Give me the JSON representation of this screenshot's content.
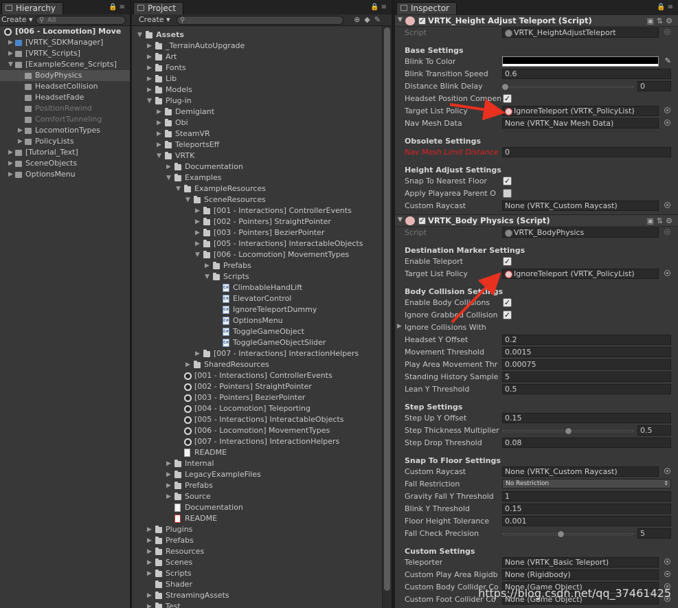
{
  "hierarchy": {
    "tab_label": "Hierarchy",
    "create_label": "Create",
    "search_placeholder": "All",
    "scene_title": "[006 - Locomotion] Move",
    "items": [
      {
        "label": "[VRTK_SDKManager]",
        "icon": "blue-cube-icon",
        "level": 1,
        "arrow": "right"
      },
      {
        "label": "[VRTK_Scripts]",
        "icon": "cube-icon",
        "level": 1,
        "arrow": "right"
      },
      {
        "label": "[ExampleScene_Scripts]",
        "icon": "cube-icon",
        "level": 1,
        "arrow": "down"
      },
      {
        "label": "BodyPhysics",
        "icon": "cube-icon",
        "level": 2,
        "arrow": "",
        "selected": true
      },
      {
        "label": "HeadsetCollision",
        "icon": "cube-icon",
        "level": 2,
        "arrow": ""
      },
      {
        "label": "HeadsetFade",
        "icon": "cube-icon",
        "level": 2,
        "arrow": ""
      },
      {
        "label": "PositionRewind",
        "icon": "cube-icon",
        "level": 2,
        "arrow": "",
        "disabled": true
      },
      {
        "label": "ComfortTunneling",
        "icon": "cube-icon",
        "level": 2,
        "arrow": "",
        "disabled": true
      },
      {
        "label": "LocomotionTypes",
        "icon": "cube-icon",
        "level": 2,
        "arrow": "right"
      },
      {
        "label": "PolicyLists",
        "icon": "cube-icon",
        "level": 2,
        "arrow": "right"
      },
      {
        "label": "[Tutorial_Text]",
        "icon": "cube-icon",
        "level": 1,
        "arrow": "right"
      },
      {
        "label": "SceneObjects",
        "icon": "cube-icon",
        "level": 1,
        "arrow": "right"
      },
      {
        "label": "OptionsMenu",
        "icon": "cube-icon",
        "level": 1,
        "arrow": "right"
      }
    ]
  },
  "project": {
    "tab_label": "Project",
    "create_label": "Create",
    "items": [
      {
        "label": "Assets",
        "icon": "folder",
        "level": 0,
        "arrow": "down",
        "bold": true
      },
      {
        "label": "_TerrainAutoUpgrade",
        "icon": "folder",
        "level": 1,
        "arrow": "right"
      },
      {
        "label": "Art",
        "icon": "folder",
        "level": 1,
        "arrow": "right"
      },
      {
        "label": "Fonts",
        "icon": "folder",
        "level": 1,
        "arrow": "right"
      },
      {
        "label": "Lib",
        "icon": "folder",
        "level": 1,
        "arrow": "right"
      },
      {
        "label": "Models",
        "icon": "folder",
        "level": 1,
        "arrow": "right"
      },
      {
        "label": "Plug-in",
        "icon": "folder",
        "level": 1,
        "arrow": "down"
      },
      {
        "label": "Demigiant",
        "icon": "folder",
        "level": 2,
        "arrow": "right"
      },
      {
        "label": "Obi",
        "icon": "folder",
        "level": 2,
        "arrow": "right"
      },
      {
        "label": "SteamVR",
        "icon": "folder",
        "level": 2,
        "arrow": "right"
      },
      {
        "label": "TeleportsEff",
        "icon": "folder",
        "level": 2,
        "arrow": "right"
      },
      {
        "label": "VRTK",
        "icon": "folder",
        "level": 2,
        "arrow": "down"
      },
      {
        "label": "Documentation",
        "icon": "folder",
        "level": 3,
        "arrow": "right"
      },
      {
        "label": "Examples",
        "icon": "folder",
        "level": 3,
        "arrow": "down"
      },
      {
        "label": "ExampleResources",
        "icon": "folder",
        "level": 4,
        "arrow": "down"
      },
      {
        "label": "SceneResources",
        "icon": "folder",
        "level": 5,
        "arrow": "down"
      },
      {
        "label": "[001 - Interactions] ControllerEvents",
        "icon": "folder",
        "level": 6,
        "arrow": "right"
      },
      {
        "label": "[002 - Pointers] StraightPointer",
        "icon": "folder",
        "level": 6,
        "arrow": "right"
      },
      {
        "label": "[003 - Pointers] BezierPointer",
        "icon": "folder",
        "level": 6,
        "arrow": "right"
      },
      {
        "label": "[005 - Interactions] InteractableObjects",
        "icon": "folder",
        "level": 6,
        "arrow": "right"
      },
      {
        "label": "[006 - Locomotion] MovementTypes",
        "icon": "folder",
        "level": 6,
        "arrow": "down"
      },
      {
        "label": "Prefabs",
        "icon": "folder",
        "level": 7,
        "arrow": "right"
      },
      {
        "label": "Scripts",
        "icon": "folder",
        "level": 7,
        "arrow": "down"
      },
      {
        "label": "ClimbableHandLift",
        "icon": "cs",
        "level": 8,
        "arrow": ""
      },
      {
        "label": "ElevatorControl",
        "icon": "cs",
        "level": 8,
        "arrow": ""
      },
      {
        "label": "IgnoreTeleportDummy",
        "icon": "cs",
        "level": 8,
        "arrow": ""
      },
      {
        "label": "OptionsMenu",
        "icon": "cs",
        "level": 8,
        "arrow": ""
      },
      {
        "label": "ToggleGameObject",
        "icon": "cs",
        "level": 8,
        "arrow": ""
      },
      {
        "label": "ToggleGameObjectSlider",
        "icon": "cs",
        "level": 8,
        "arrow": ""
      },
      {
        "label": "[007 - Interactions] InteractionHelpers",
        "icon": "folder",
        "level": 6,
        "arrow": "right"
      },
      {
        "label": "SharedResources",
        "icon": "folder",
        "level": 5,
        "arrow": "right"
      },
      {
        "label": "[001 - Interactions] ControllerEvents",
        "icon": "unity",
        "level": 4,
        "arrow": ""
      },
      {
        "label": "[002 - Pointers] StraightPointer",
        "icon": "unity",
        "level": 4,
        "arrow": ""
      },
      {
        "label": "[003 - Pointers] BezierPointer",
        "icon": "unity",
        "level": 4,
        "arrow": ""
      },
      {
        "label": "[004 - Locomotion] Teleporting",
        "icon": "unity",
        "level": 4,
        "arrow": ""
      },
      {
        "label": "[005 - Interactions] InteractableObjects",
        "icon": "unity",
        "level": 4,
        "arrow": ""
      },
      {
        "label": "[006 - Locomotion] MovementTypes",
        "icon": "unity",
        "level": 4,
        "arrow": ""
      },
      {
        "label": "[007 - Interactions] InteractionHelpers",
        "icon": "unity",
        "level": 4,
        "arrow": ""
      },
      {
        "label": "README",
        "icon": "doc",
        "level": 4,
        "arrow": ""
      },
      {
        "label": "Internal",
        "icon": "folder",
        "level": 3,
        "arrow": "right"
      },
      {
        "label": "LegacyExampleFiles",
        "icon": "folder",
        "level": 3,
        "arrow": "right"
      },
      {
        "label": "Prefabs",
        "icon": "folder",
        "level": 3,
        "arrow": "right"
      },
      {
        "label": "Source",
        "icon": "folder",
        "level": 3,
        "arrow": "right"
      },
      {
        "label": "Documentation",
        "icon": "doc",
        "level": 3,
        "arrow": ""
      },
      {
        "label": "README",
        "icon": "pdf",
        "level": 3,
        "arrow": ""
      },
      {
        "label": "Plugins",
        "icon": "folder",
        "level": 1,
        "arrow": "right"
      },
      {
        "label": "Prefabs",
        "icon": "folder",
        "level": 1,
        "arrow": "right"
      },
      {
        "label": "Resources",
        "icon": "folder",
        "level": 1,
        "arrow": "right"
      },
      {
        "label": "Scenes",
        "icon": "folder",
        "level": 1,
        "arrow": "right"
      },
      {
        "label": "Scripts",
        "icon": "folder",
        "level": 1,
        "arrow": "right"
      },
      {
        "label": "Shader",
        "icon": "folder",
        "level": 1,
        "arrow": ""
      },
      {
        "label": "StreamingAssets",
        "icon": "folder",
        "level": 1,
        "arrow": "right"
      },
      {
        "label": "Test",
        "icon": "folder",
        "level": 1,
        "arrow": "right"
      }
    ]
  },
  "inspector": {
    "tab_label": "Inspector",
    "comp1": {
      "title": "VRTK_Height Adjust Teleport (Script)",
      "script_label": "Script",
      "script_value": "VRTK_HeightAdjustTeleport",
      "base_header": "Base Settings",
      "blink_color_label": "Blink To Color",
      "blink_speed_label": "Blink Transition Speed",
      "blink_speed_value": "0.6",
      "distance_blink_label": "Distance Blink Delay",
      "distance_blink_value": "0",
      "headset_comp_label": "Headset Position Compen",
      "target_policy_label": "Target List Policy",
      "target_policy_value": "IgnoreTeleport (VRTK_PolicyList)",
      "navmesh_label": "Nav Mesh Data",
      "navmesh_value": "None (VRTK_Nav Mesh Data)",
      "obsolete_header": "Obsolete Settings",
      "navmesh_limit_label": "Nav Mesh Limit Distance",
      "navmesh_limit_value": "0",
      "height_header": "Height Adjust Settings",
      "snap_floor_label": "Snap To Nearest Floor",
      "apply_parent_label": "Apply Playarea Parent O",
      "custom_raycast_label": "Custom Raycast",
      "custom_raycast_value": "None (VRTK_Custom Raycast)"
    },
    "comp2": {
      "title": "VRTK_Body Physics (Script)",
      "script_label": "Script",
      "script_value": "VRTK_BodyPhysics",
      "dest_header": "Destination Marker Settings",
      "enable_teleport_label": "Enable Teleport",
      "target_policy_label": "Target List Policy",
      "target_policy_value": "IgnoreTeleport (VRTK_PolicyList)",
      "collision_header": "Body Collision Settings",
      "enable_collisions_label": "Enable Body Collisions",
      "ignore_grabbed_label": "Ignore Grabbed Collision",
      "ignore_with_label": "Ignore Collisions With",
      "headset_y_label": "Headset Y Offset",
      "headset_y_value": "0.2",
      "movement_thr_label": "Movement Threshold",
      "movement_thr_value": "0.0015",
      "playarea_thr_label": "Play Area Movement Thr",
      "playarea_thr_value": "0.00075",
      "standing_label": "Standing History Sample",
      "standing_value": "5",
      "lean_label": "Lean Y Threshold",
      "lean_value": "0.5",
      "step_header": "Step Settings",
      "step_up_label": "Step Up Y Offset",
      "step_up_value": "0.15",
      "step_thick_label": "Step Thickness Multiplier",
      "step_thick_value": "0.5",
      "step_drop_label": "Step Drop Threshold",
      "step_drop_value": "0.08",
      "snap_header": "Snap To Floor Settings",
      "custom_raycast_label": "Custom Raycast",
      "custom_raycast_value": "None (VRTK_Custom Raycast)",
      "fall_restr_label": "Fall Restriction",
      "fall_restr_value": "No Restriction",
      "gravity_label": "Gravity Fall Y Threshold",
      "gravity_value": "1",
      "blink_y_label": "Blink Y Threshold",
      "blink_y_value": "0.15",
      "floor_tol_label": "Floor Height Tolerance",
      "floor_tol_value": "0.001",
      "fall_check_label": "Fall Check Precision",
      "fall_check_value": "5",
      "custom_header": "Custom Settings",
      "teleporter_label": "Teleporter",
      "teleporter_value": "None (VRTK_Basic Teleport)",
      "custom_rigid_label": "Custom Play Area Rigidb",
      "custom_rigid_value": "None (Rigidbody)",
      "custom_body_label": "Custom Body Collider Co",
      "custom_body_value": "None (Game Object)",
      "custom_foot_label": "Custom Foot Collider Co",
      "custom_foot_value": "None (Game Object)"
    }
  },
  "watermark": "https://blog.csdn.net/qq_37461425",
  "colors": {
    "panel": "#383838",
    "arrow": "#e8311f",
    "selected": "#4d4d4d"
  }
}
